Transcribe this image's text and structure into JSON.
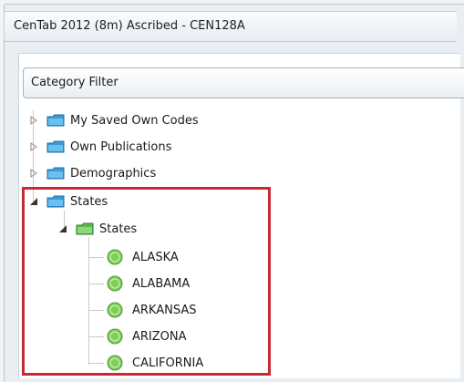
{
  "window": {
    "title": "CenTab 2012 (8m) Ascribed - CEN128A"
  },
  "filter": {
    "title": "Category Filter"
  },
  "tree": {
    "top_level": [
      {
        "label": "My Saved Own Codes",
        "expanded": false
      },
      {
        "label": "Own Publications",
        "expanded": false
      },
      {
        "label": "Demographics",
        "expanded": false
      },
      {
        "label": "States",
        "expanded": true
      }
    ],
    "child": {
      "label": "States",
      "expanded": true
    },
    "leaves": [
      "ALASKA",
      "ALABAMA",
      "ARKANSAS",
      "ARIZONA",
      "CALIFORNIA"
    ]
  },
  "colors": {
    "folder": "#3a9bd8",
    "folder_open": "#58b94a",
    "leaf_icon": "#7fce58",
    "highlight": "#c62a36"
  },
  "icons": {
    "collapsed": "triangle-right-icon",
    "expanded": "triangle-down-icon",
    "folder": "folder-icon",
    "leaf": "circle-add-icon"
  }
}
